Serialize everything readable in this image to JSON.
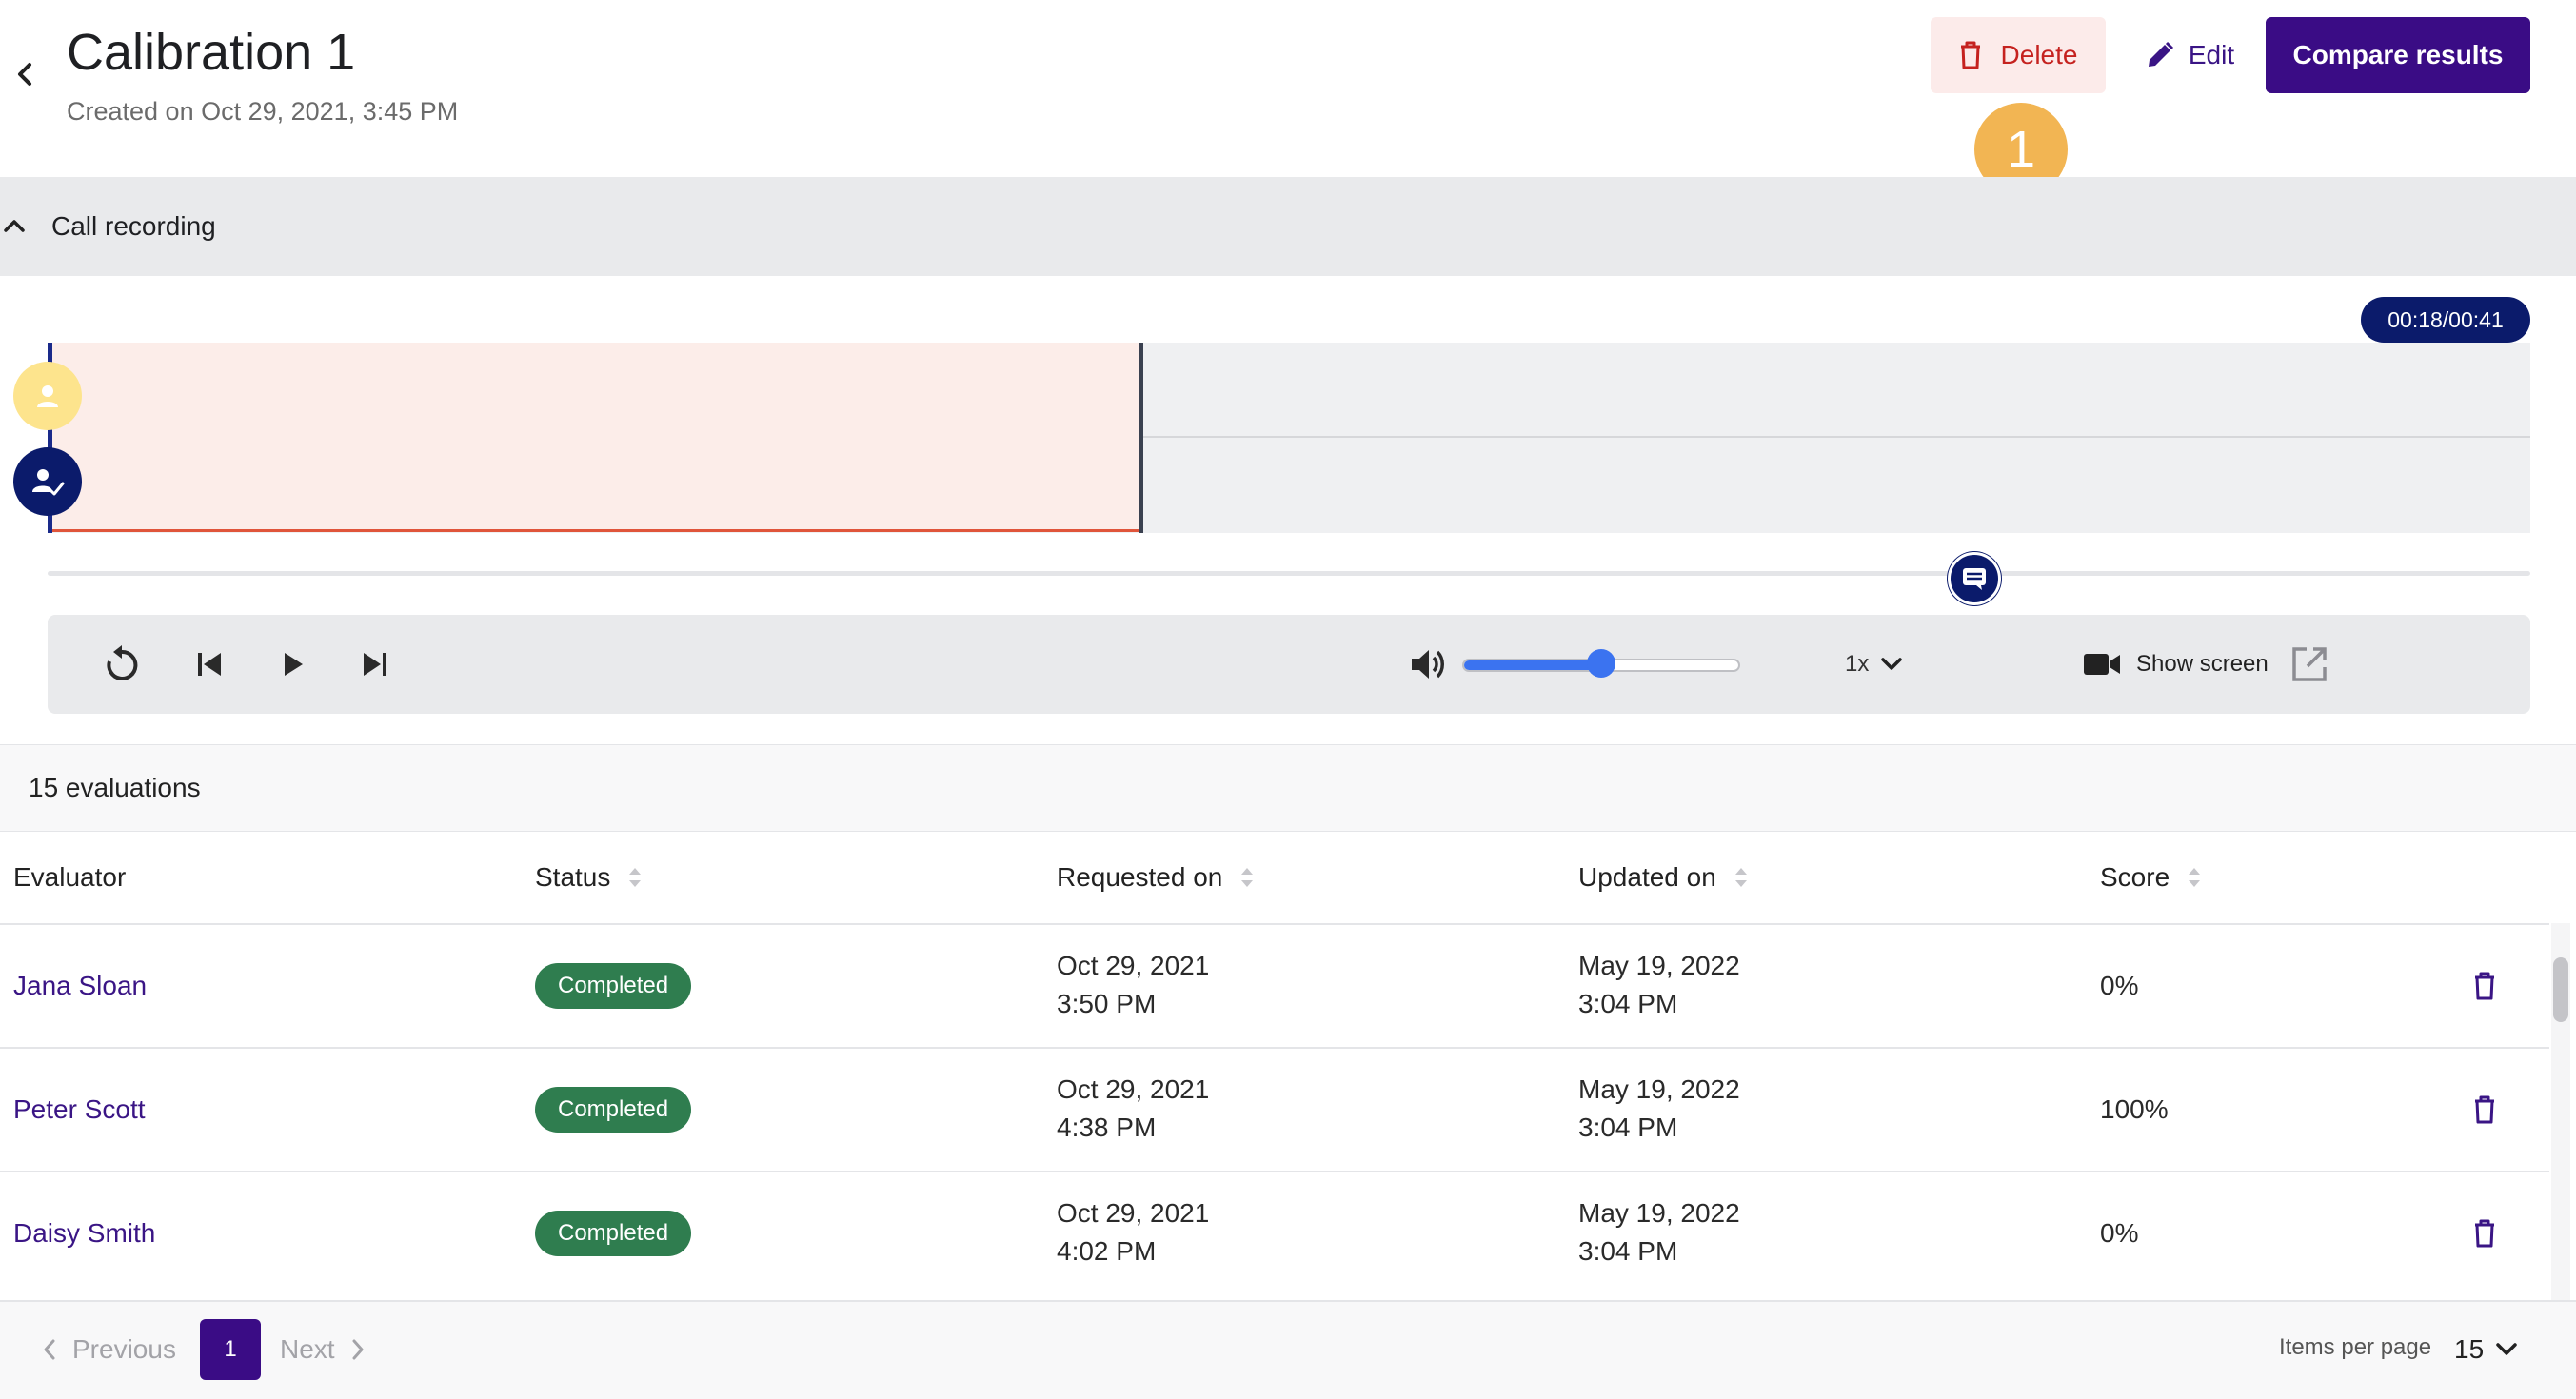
{
  "header": {
    "title": "Calibration 1",
    "subtitle": "Created on Oct 29, 2021, 3:45 PM",
    "delete_label": "Delete",
    "edit_label": "Edit",
    "compare_label": "Compare results",
    "step_badge": "1"
  },
  "recording": {
    "section_title": "Call recording",
    "time_display": "00:18/00:41",
    "progress": 0.44,
    "volume": 0.5,
    "speed": "1x",
    "show_screen_label": "Show screen",
    "colors": {
      "accent": "#3a0c85",
      "played": "#e0553b",
      "volume": "#3b73f0",
      "customer_avatar": "#fde48d",
      "agent_avatar": "#0b1b6b"
    }
  },
  "evaluations": {
    "count_label": "15 evaluations",
    "columns": [
      "Evaluator",
      "Status",
      "Requested on",
      "Updated on",
      "Score"
    ],
    "rows": [
      {
        "evaluator": "Jana Sloan",
        "status": "Completed",
        "requested_date": "Oct 29, 2021",
        "requested_time": "3:50 PM",
        "updated_date": "May 19, 2022",
        "updated_time": "3:04 PM",
        "score": "0%"
      },
      {
        "evaluator": "Peter Scott",
        "status": "Completed",
        "requested_date": "Oct 29, 2021",
        "requested_time": "4:38 PM",
        "updated_date": "May 19, 2022",
        "updated_time": "3:04 PM",
        "score": "100%"
      },
      {
        "evaluator": "Daisy Smith",
        "status": "Completed",
        "requested_date": "Oct 29, 2021",
        "requested_time": "4:02 PM",
        "updated_date": "May 19, 2022",
        "updated_time": "3:04 PM",
        "score": "0%"
      }
    ],
    "status_color": "#2f7d4f"
  },
  "pagination": {
    "previous_label": "Previous",
    "current_page": "1",
    "next_label": "Next",
    "items_per_page_label": "Items per page",
    "items_per_page": "15"
  }
}
